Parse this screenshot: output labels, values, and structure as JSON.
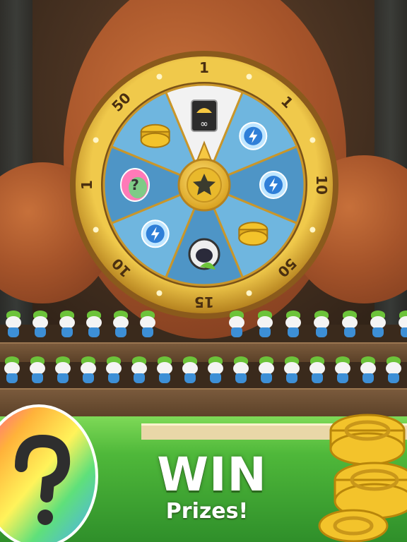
{
  "wheel": {
    "segment_values": [
      "1",
      "1",
      "10",
      "50",
      "15",
      "10",
      "1",
      "50"
    ],
    "segment_prizes": [
      "infinite-umbrella-card-icon",
      "speed-boost-refresh-icon",
      "lightning-potion-icon",
      "gold-coin-stack-icon",
      "hooded-costume-icon",
      "lightning-bulb-potion-icon",
      "mystery-egg-icon",
      "gold-coin-stack-icon"
    ],
    "center_icon": "star-icon",
    "pointer_icon": "pointer-arrow-icon",
    "colors": {
      "rim": "#e2b23a",
      "rim_dark": "#b5821f",
      "segment_a": "#4e95c6",
      "segment_b": "#6fb6df",
      "segment_highlight": "#f2f2f2",
      "center": "#f6c842"
    }
  },
  "headline": {
    "title": "WIN",
    "subtitle": "Prizes!"
  },
  "decor": {
    "left_item": "mystery-egg-icon",
    "right_item": "gold-coins-icon"
  }
}
